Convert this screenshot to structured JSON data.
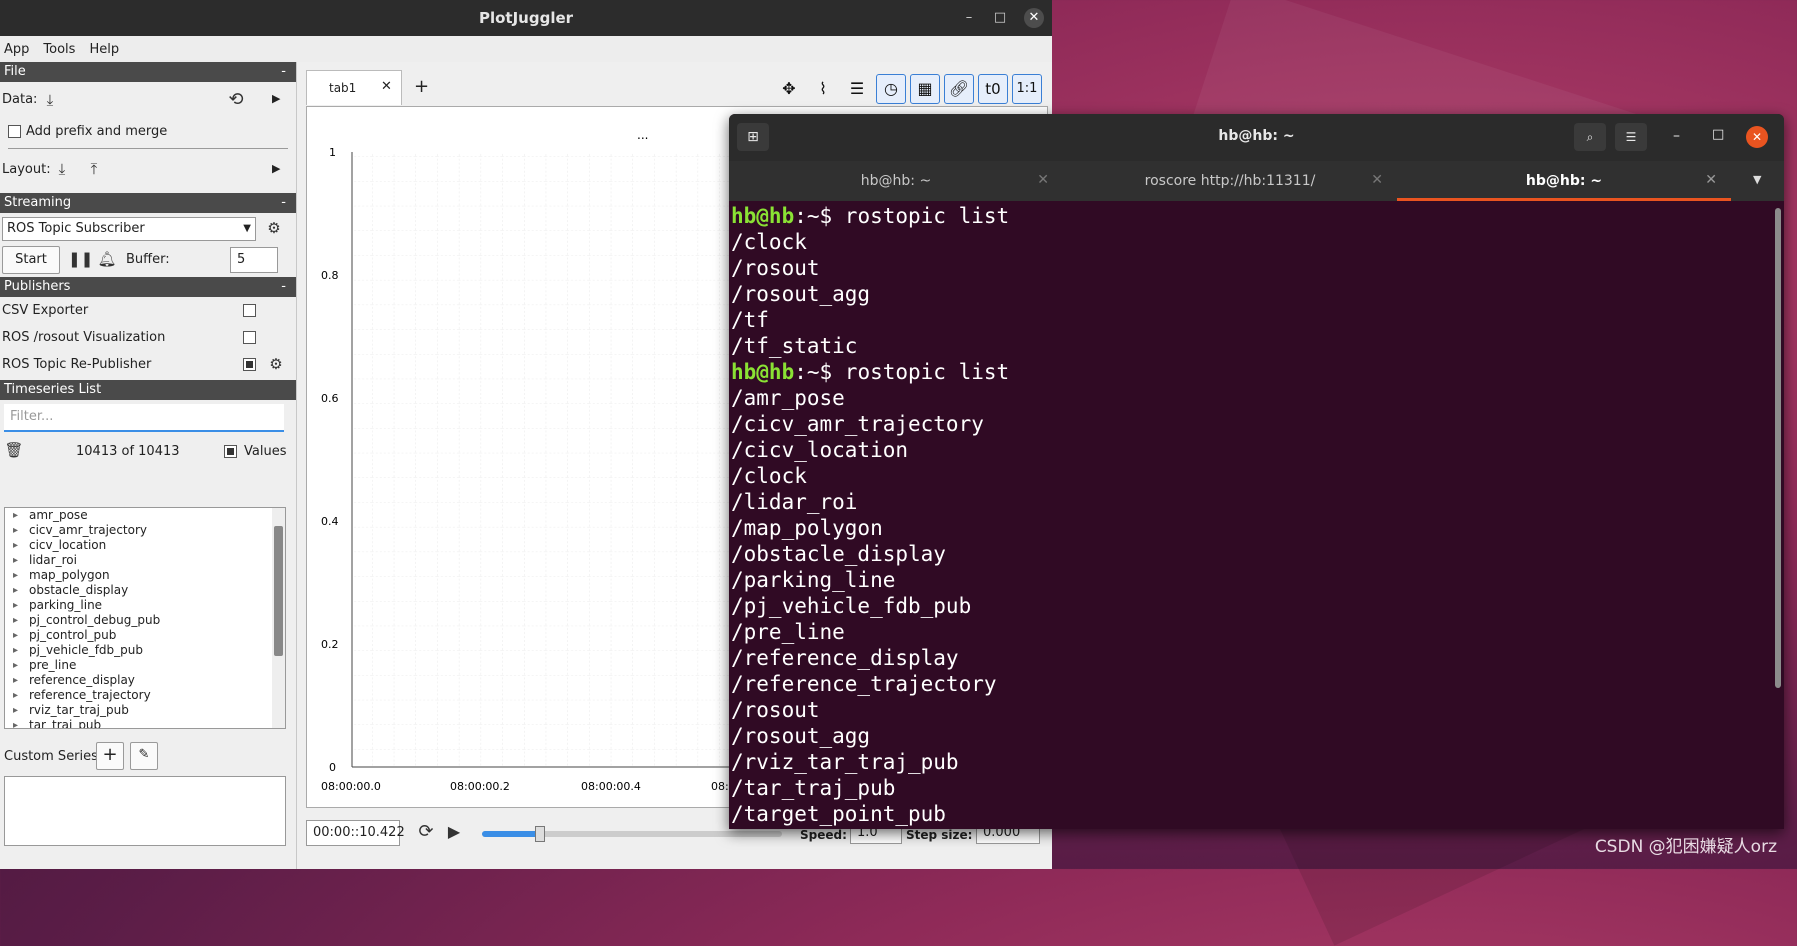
{
  "desktop": {
    "watermark": "CSDN @犯困嫌疑人orz"
  },
  "pj_window": {
    "title": "PlotJuggler",
    "menu": [
      "App",
      "Tools",
      "Help"
    ],
    "sections": {
      "file": {
        "title": "File",
        "collapse": "-",
        "data_label": "Data:",
        "prefix_label": "Add prefix and merge",
        "layout_label": "Layout:"
      },
      "streaming": {
        "title": "Streaming",
        "collapse": "-",
        "source": "ROS Topic Subscriber",
        "start": "Start",
        "buffer_label": "Buffer:",
        "buffer_value": "5"
      },
      "publishers": {
        "title": "Publishers",
        "collapse": "-",
        "items": [
          {
            "label": "CSV Exporter",
            "checked": false
          },
          {
            "label": "ROS /rosout Visualization",
            "checked": false
          },
          {
            "label": "ROS Topic Re-Publisher",
            "checked": true
          }
        ]
      },
      "timeseries": {
        "title": "Timeseries List",
        "filter_placeholder": "Filter...",
        "count": "10413 of 10413",
        "values_label": "Values",
        "items": [
          "amr_pose",
          "cicv_amr_trajectory",
          "cicv_location",
          "lidar_roi",
          "map_polygon",
          "obstacle_display",
          "parking_line",
          "pj_control_debug_pub",
          "pj_control_pub",
          "pj_vehicle_fdb_pub",
          "pre_line",
          "reference_display",
          "reference_trajectory",
          "rviz_tar_traj_pub",
          "tar_traj_pub"
        ],
        "custom_label": "Custom Series:"
      }
    },
    "plot": {
      "tab_label": "tab1",
      "add_tab": "+",
      "plot_title": "...",
      "y_ticks": [
        "1",
        "0.8",
        "0.6",
        "0.4",
        "0.2",
        "0"
      ],
      "x_ticks": [
        "08:00:00.0",
        "08:00:00.2",
        "08:00:00.4",
        "08:"
      ],
      "time_value": "00:00::10.422",
      "playback_fraction": 0.19,
      "speed_label": "Speed:",
      "speed_value": "1.0",
      "step_label": "Step size:",
      "step_value": "0.000",
      "toolbar_extra": [
        "t0",
        "1:1"
      ]
    }
  },
  "terminal": {
    "title": "hb@hb: ~",
    "tabs": [
      {
        "label": "hb@hb: ~",
        "active": false
      },
      {
        "label": "roscore http://hb:11311/",
        "active": false
      },
      {
        "label": "hb@hb: ~",
        "active": true
      }
    ],
    "prompt_user": "hb@hb",
    "prompt_rest": ":~$ ",
    "lines": [
      {
        "prompt": true,
        "text": "rostopic list"
      },
      {
        "text": "/clock"
      },
      {
        "text": "/rosout"
      },
      {
        "text": "/rosout_agg"
      },
      {
        "text": "/tf"
      },
      {
        "text": "/tf_static"
      },
      {
        "prompt": true,
        "text": "rostopic list"
      },
      {
        "text": "/amr_pose"
      },
      {
        "text": "/cicv_amr_trajectory"
      },
      {
        "text": "/cicv_location"
      },
      {
        "text": "/clock"
      },
      {
        "text": "/lidar_roi"
      },
      {
        "text": "/map_polygon"
      },
      {
        "text": "/obstacle_display"
      },
      {
        "text": "/parking_line"
      },
      {
        "text": "/pj_vehicle_fdb_pub"
      },
      {
        "text": "/pre_line"
      },
      {
        "text": "/reference_display"
      },
      {
        "text": "/reference_trajectory"
      },
      {
        "text": "/rosout"
      },
      {
        "text": "/rosout_agg"
      },
      {
        "text": "/rviz_tar_traj_pub"
      },
      {
        "text": "/tar_traj_pub"
      },
      {
        "text": "/target_point_pub"
      }
    ]
  },
  "colors": {
    "terminal_bg": "#300a24",
    "prompt_green": "#8ae234",
    "tab_accent": "#e95420"
  }
}
